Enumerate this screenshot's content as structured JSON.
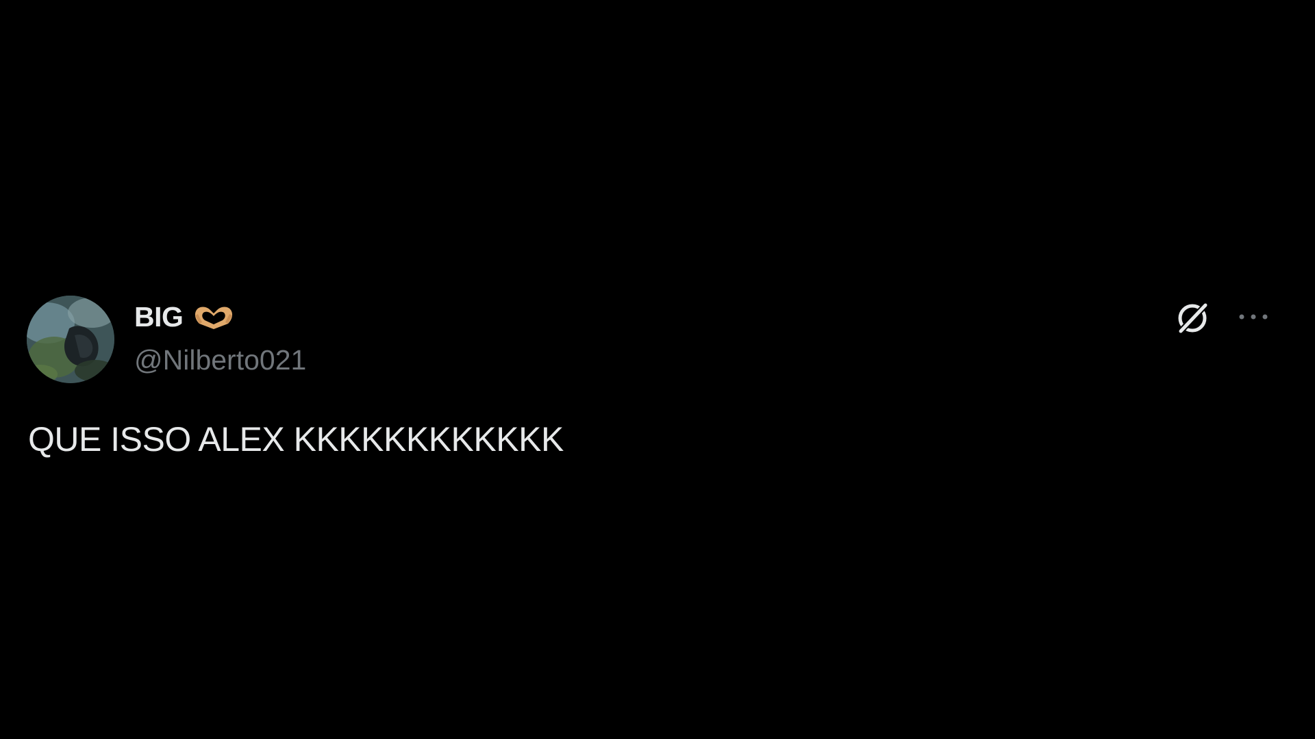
{
  "post": {
    "author": {
      "display_name": "BIG",
      "handle": "@Nilberto021",
      "name_emoji_icon": "heart-hands-icon"
    },
    "text": "QUE ISSO ALEX KKKKKKKKKKKK",
    "actions": {
      "grok_icon": "grok-icon",
      "more_icon": "more-options-icon"
    }
  },
  "colors": {
    "background": "#000000",
    "primary_text": "#e7e9ea",
    "secondary_text": "#71767b",
    "emoji": "#e0a96b"
  }
}
